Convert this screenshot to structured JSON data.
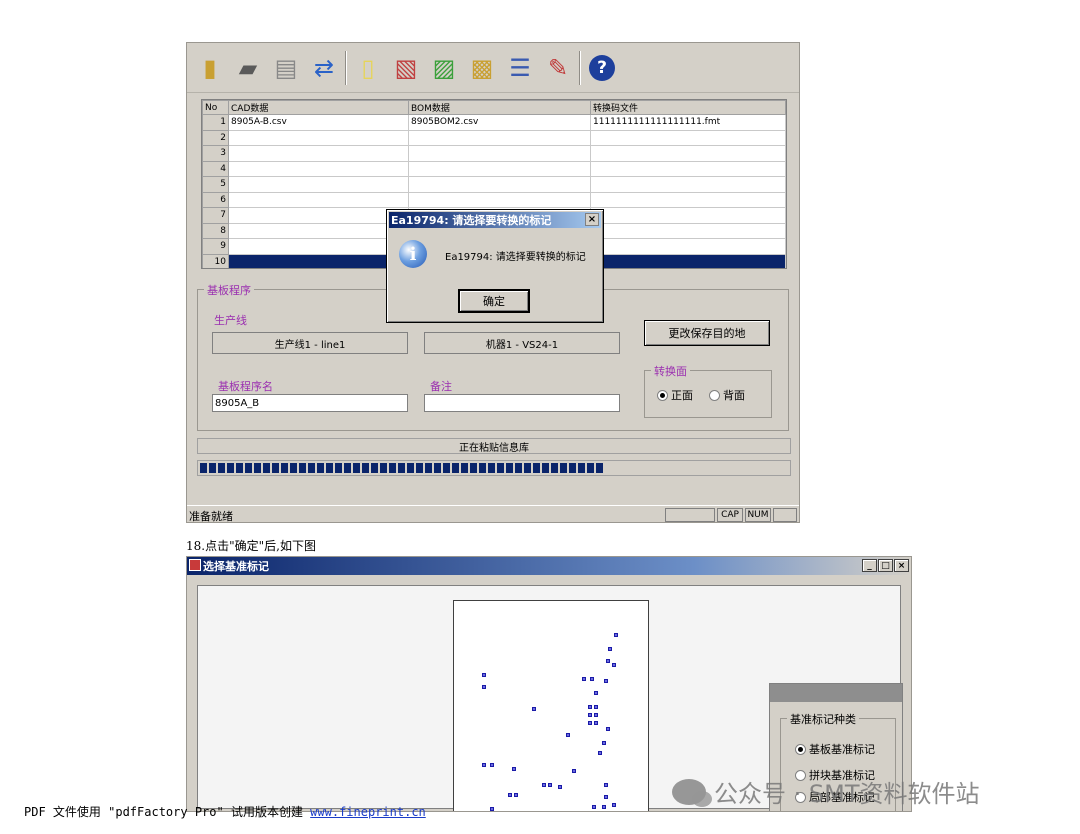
{
  "app": {
    "toolbar_icons": [
      "open-folder-icon",
      "comment-icon",
      "edit-document-icon",
      "refresh-icon",
      "new-file-icon",
      "document-edit-icon",
      "import-icon",
      "convert-icon",
      "list-icon",
      "settings-icon",
      "help-icon"
    ],
    "grid": {
      "headers": [
        "No",
        "CAD数据",
        "BOM数据",
        "转换码文件"
      ],
      "rows": [
        {
          "no": "1",
          "cad": "8905A-B.csv",
          "bom": "8905BOM2.csv",
          "fmt": "1111111111111111111.fmt"
        },
        {
          "no": "2",
          "cad": "",
          "bom": "",
          "fmt": ""
        },
        {
          "no": "3",
          "cad": "",
          "bom": "",
          "fmt": ""
        },
        {
          "no": "4",
          "cad": "",
          "bom": "",
          "fmt": ""
        },
        {
          "no": "5",
          "cad": "",
          "bom": "",
          "fmt": ""
        },
        {
          "no": "6",
          "cad": "",
          "bom": "",
          "fmt": ""
        },
        {
          "no": "7",
          "cad": "",
          "bom": "",
          "fmt": ""
        },
        {
          "no": "8",
          "cad": "",
          "bom": "",
          "fmt": ""
        },
        {
          "no": "9",
          "cad": "",
          "bom": "",
          "fmt": ""
        },
        {
          "no": "10",
          "cad": "",
          "bom": "",
          "fmt": ""
        }
      ]
    },
    "board_program": {
      "title": "基板程序",
      "line_label": "生产线",
      "line_value": "生产线1 - line1",
      "machine_value": "机器1 - VS24-1",
      "change_dest_button": "更改保存目的地",
      "side_group_title": "转换面",
      "side_front": "正面",
      "side_back": "背面",
      "program_name_label": "基板程序名",
      "program_name_value": "8905A_B",
      "remark_label": "备注",
      "remark_value": ""
    },
    "status_strip_text": "正在粘贴信息库",
    "progress_fraction": 0.69,
    "statusbar": {
      "ready": "准备就绪",
      "cap": "CAP",
      "num": "NUM"
    },
    "msgbox": {
      "title": "Ea19794: 请选择要转换的标记",
      "close": "×",
      "message": "Ea19794: 请选择要转换的标记",
      "ok_button": "确定"
    }
  },
  "caption": "18.点击\"确定\"后,如下图",
  "window2": {
    "title": "选择基准标记",
    "minimize": "_",
    "maximize": "□",
    "close": "×",
    "fid_group_title": "基准标记种类",
    "fid_options": [
      "基板基准标记",
      "拼块基准标记",
      "局部基准标记"
    ]
  },
  "footer": {
    "text": "PDF 文件使用 \"pdfFactory Pro\" 试用版本创建 ",
    "link": "www.fineprint.cn"
  },
  "watermark": "公众号 · SMT资料软件站"
}
